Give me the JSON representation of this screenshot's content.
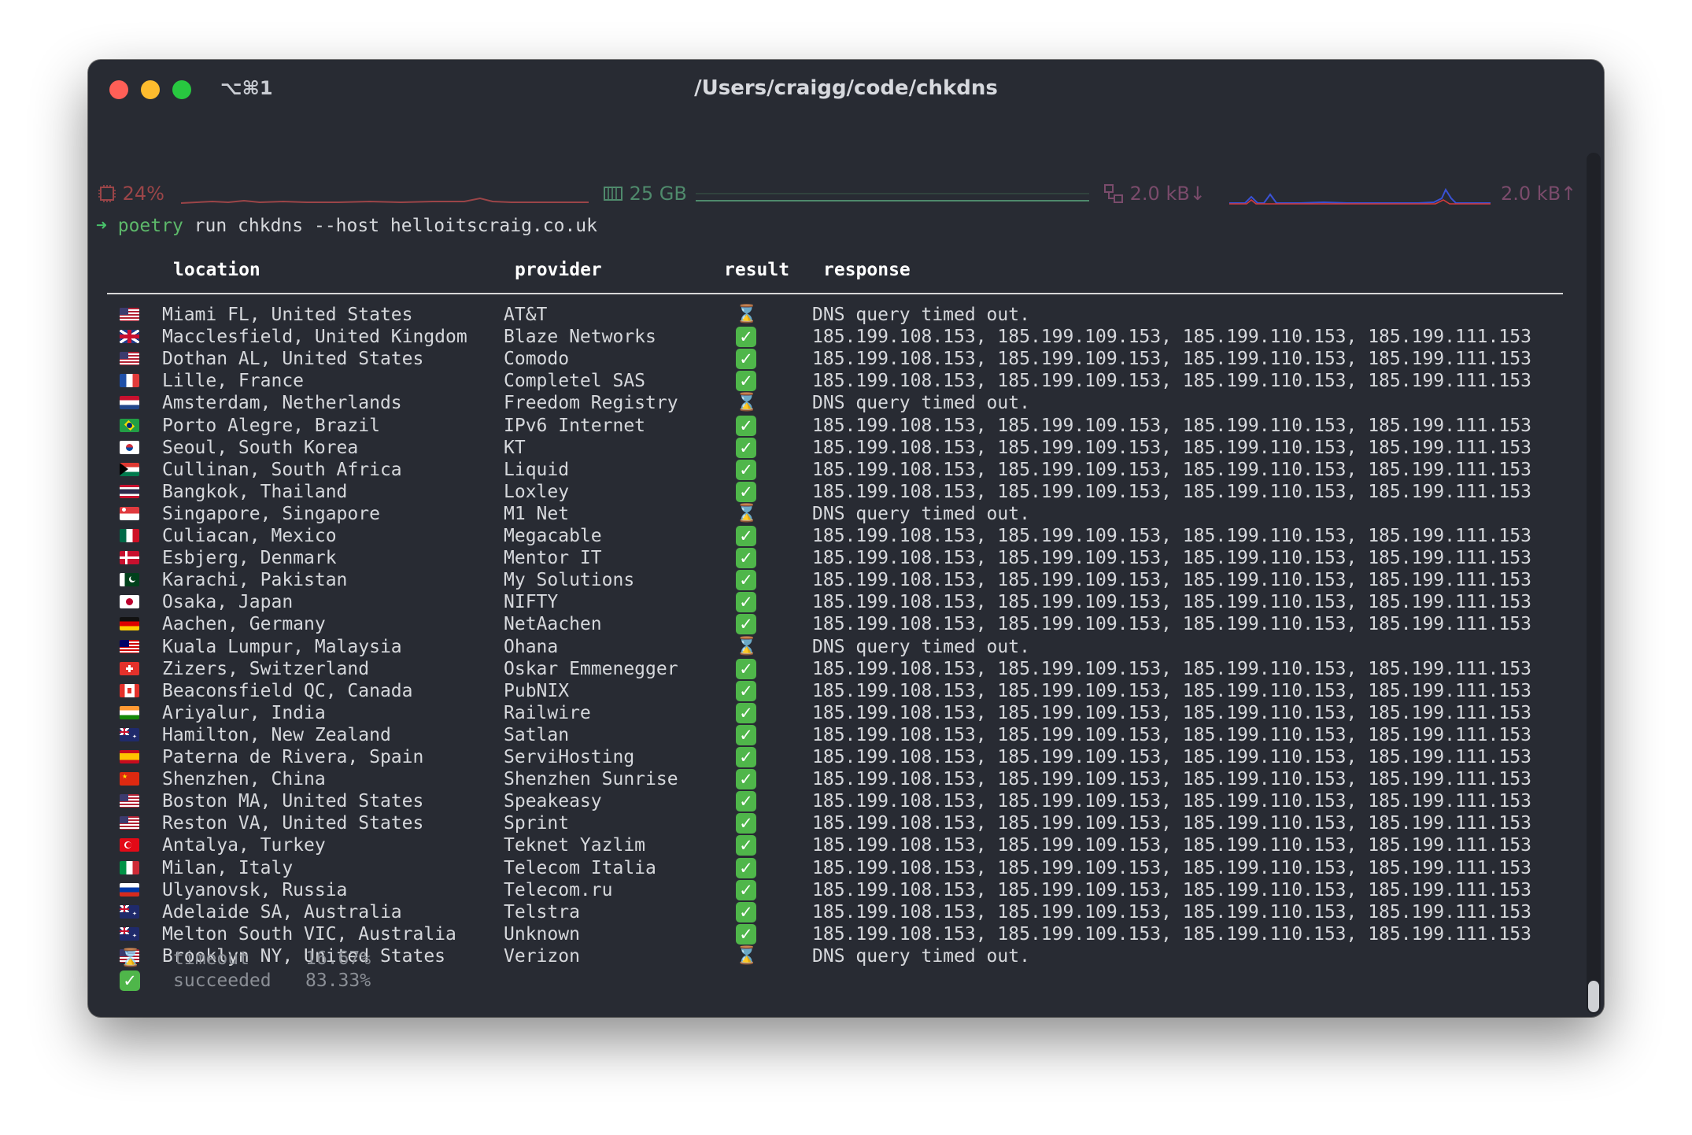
{
  "window": {
    "shortcut": "⌥⌘1",
    "title": "/Users/craigg/code/chkdns"
  },
  "status": {
    "cpu": "24%",
    "memory": "25 GB",
    "net_down": "2.0 kB↓",
    "net_up": "2.0 kB↑",
    "colors": {
      "cpu": "#9b4548",
      "memory": "#4f8a6c",
      "net_down": "#3a52d6",
      "net_up": "#d23b3b"
    }
  },
  "prompt": {
    "arrow": "➜",
    "command": "poetry",
    "args": " run chkdns --host helloitscraig.co.uk"
  },
  "table": {
    "headers": {
      "location": "location",
      "provider": "provider",
      "result": "result",
      "response": "response"
    },
    "rows": [
      {
        "flag": "us",
        "location": "Miami FL, United States",
        "provider": "AT&T",
        "result": "timeout",
        "response": "DNS query timed out."
      },
      {
        "flag": "gb",
        "location": "Macclesfield, United Kingdom",
        "provider": "Blaze Networks",
        "result": "ok",
        "response": "185.199.108.153, 185.199.109.153, 185.199.110.153, 185.199.111.153"
      },
      {
        "flag": "us",
        "location": "Dothan AL, United States",
        "provider": "Comodo",
        "result": "ok",
        "response": "185.199.108.153, 185.199.109.153, 185.199.110.153, 185.199.111.153"
      },
      {
        "flag": "fr",
        "location": "Lille, France",
        "provider": "Completel SAS",
        "result": "ok",
        "response": "185.199.108.153, 185.199.109.153, 185.199.110.153, 185.199.111.153"
      },
      {
        "flag": "nl",
        "location": "Amsterdam, Netherlands",
        "provider": "Freedom Registry",
        "result": "timeout",
        "response": "DNS query timed out."
      },
      {
        "flag": "br",
        "location": "Porto Alegre, Brazil",
        "provider": "IPv6 Internet",
        "result": "ok",
        "response": "185.199.108.153, 185.199.109.153, 185.199.110.153, 185.199.111.153"
      },
      {
        "flag": "kr",
        "location": "Seoul, South Korea",
        "provider": "KT",
        "result": "ok",
        "response": "185.199.108.153, 185.199.109.153, 185.199.110.153, 185.199.111.153"
      },
      {
        "flag": "za",
        "location": "Cullinan, South Africa",
        "provider": "Liquid",
        "result": "ok",
        "response": "185.199.108.153, 185.199.109.153, 185.199.110.153, 185.199.111.153"
      },
      {
        "flag": "th",
        "location": "Bangkok, Thailand",
        "provider": "Loxley",
        "result": "ok",
        "response": "185.199.108.153, 185.199.109.153, 185.199.110.153, 185.199.111.153"
      },
      {
        "flag": "sg",
        "location": "Singapore, Singapore",
        "provider": "M1 Net",
        "result": "timeout",
        "response": "DNS query timed out."
      },
      {
        "flag": "mx",
        "location": "Culiacan, Mexico",
        "provider": "Megacable",
        "result": "ok",
        "response": "185.199.108.153, 185.199.109.153, 185.199.110.153, 185.199.111.153"
      },
      {
        "flag": "dk",
        "location": "Esbjerg, Denmark",
        "provider": "Mentor IT",
        "result": "ok",
        "response": "185.199.108.153, 185.199.109.153, 185.199.110.153, 185.199.111.153"
      },
      {
        "flag": "pk",
        "location": "Karachi, Pakistan",
        "provider": "My Solutions",
        "result": "ok",
        "response": "185.199.108.153, 185.199.109.153, 185.199.110.153, 185.199.111.153"
      },
      {
        "flag": "jp",
        "location": "Osaka, Japan",
        "provider": "NIFTY",
        "result": "ok",
        "response": "185.199.108.153, 185.199.109.153, 185.199.110.153, 185.199.111.153"
      },
      {
        "flag": "de",
        "location": "Aachen, Germany",
        "provider": "NetAachen",
        "result": "ok",
        "response": "185.199.108.153, 185.199.109.153, 185.199.110.153, 185.199.111.153"
      },
      {
        "flag": "my",
        "location": "Kuala Lumpur, Malaysia",
        "provider": "Ohana",
        "result": "timeout",
        "response": "DNS query timed out."
      },
      {
        "flag": "ch",
        "location": "Zizers, Switzerland",
        "provider": "Oskar Emmenegger",
        "result": "ok",
        "response": "185.199.108.153, 185.199.109.153, 185.199.110.153, 185.199.111.153"
      },
      {
        "flag": "ca",
        "location": "Beaconsfield QC, Canada",
        "provider": "PubNIX",
        "result": "ok",
        "response": "185.199.108.153, 185.199.109.153, 185.199.110.153, 185.199.111.153"
      },
      {
        "flag": "in",
        "location": "Ariyalur, India",
        "provider": "Railwire",
        "result": "ok",
        "response": "185.199.108.153, 185.199.109.153, 185.199.110.153, 185.199.111.153"
      },
      {
        "flag": "nz",
        "location": "Hamilton, New Zealand",
        "provider": "Satlan",
        "result": "ok",
        "response": "185.199.108.153, 185.199.109.153, 185.199.110.153, 185.199.111.153"
      },
      {
        "flag": "es",
        "location": "Paterna de Rivera, Spain",
        "provider": "ServiHosting",
        "result": "ok",
        "response": "185.199.108.153, 185.199.109.153, 185.199.110.153, 185.199.111.153"
      },
      {
        "flag": "cn",
        "location": "Shenzhen, China",
        "provider": "Shenzhen Sunrise",
        "result": "ok",
        "response": "185.199.108.153, 185.199.109.153, 185.199.110.153, 185.199.111.153"
      },
      {
        "flag": "us",
        "location": "Boston MA, United States",
        "provider": "Speakeasy",
        "result": "ok",
        "response": "185.199.108.153, 185.199.109.153, 185.199.110.153, 185.199.111.153"
      },
      {
        "flag": "us",
        "location": "Reston VA, United States",
        "provider": "Sprint",
        "result": "ok",
        "response": "185.199.108.153, 185.199.109.153, 185.199.110.153, 185.199.111.153"
      },
      {
        "flag": "tr",
        "location": "Antalya, Turkey",
        "provider": "Teknet Yazlim",
        "result": "ok",
        "response": "185.199.108.153, 185.199.109.153, 185.199.110.153, 185.199.111.153"
      },
      {
        "flag": "it",
        "location": "Milan, Italy",
        "provider": "Telecom Italia",
        "result": "ok",
        "response": "185.199.108.153, 185.199.109.153, 185.199.110.153, 185.199.111.153"
      },
      {
        "flag": "ru",
        "location": "Ulyanovsk, Russia",
        "provider": "Telecom.ru",
        "result": "ok",
        "response": "185.199.108.153, 185.199.109.153, 185.199.110.153, 185.199.111.153"
      },
      {
        "flag": "au",
        "location": "Adelaide SA, Australia",
        "provider": "Telstra",
        "result": "ok",
        "response": "185.199.108.153, 185.199.109.153, 185.199.110.153, 185.199.111.153"
      },
      {
        "flag": "au",
        "location": "Melton South VIC, Australia",
        "provider": "Unknown",
        "result": "ok",
        "response": "185.199.108.153, 185.199.109.153, 185.199.110.153, 185.199.111.153"
      },
      {
        "flag": "us",
        "location": "Brooklyn NY, United States",
        "provider": "Verizon",
        "result": "timeout",
        "response": "DNS query timed out."
      }
    ]
  },
  "summary": [
    {
      "icon": "timeout",
      "label": "timeout",
      "value": "16.67%"
    },
    {
      "icon": "ok",
      "label": "succeeded",
      "value": "83.33%"
    }
  ]
}
